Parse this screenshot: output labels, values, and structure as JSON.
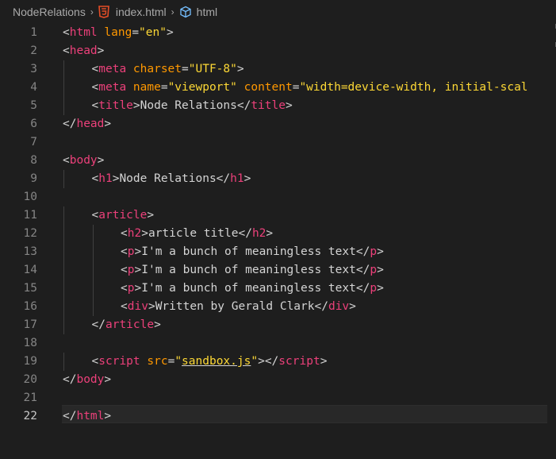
{
  "breadcrumb": {
    "folder": "NodeRelations",
    "file": "index.html",
    "symbol": "html",
    "separator": "›"
  },
  "editor": {
    "active_line": 22,
    "colors": {
      "background": "#1e1e1e",
      "tag": "#ec407a",
      "attribute": "#ff9800",
      "string": "#fdd835",
      "text": "#d4d4d4",
      "line_number": "#858585"
    },
    "lines": [
      {
        "n": "1",
        "indent": 0,
        "tokens": [
          [
            "br",
            "<"
          ],
          [
            "tag",
            "html"
          ],
          [
            "txt",
            " "
          ],
          [
            "attr",
            "lang"
          ],
          [
            "eq",
            "="
          ],
          [
            "str",
            "\"en\""
          ],
          [
            "br",
            ">"
          ]
        ]
      },
      {
        "n": "2",
        "indent": 0,
        "tokens": [
          [
            "br",
            "<"
          ],
          [
            "tag",
            "head"
          ],
          [
            "br",
            ">"
          ]
        ]
      },
      {
        "n": "3",
        "indent": 4,
        "tokens": [
          [
            "br",
            "<"
          ],
          [
            "tag",
            "meta"
          ],
          [
            "txt",
            " "
          ],
          [
            "attr",
            "charset"
          ],
          [
            "eq",
            "="
          ],
          [
            "str",
            "\"UTF-8\""
          ],
          [
            "br",
            ">"
          ]
        ]
      },
      {
        "n": "4",
        "indent": 4,
        "tokens": [
          [
            "br",
            "<"
          ],
          [
            "tag",
            "meta"
          ],
          [
            "txt",
            " "
          ],
          [
            "attr",
            "name"
          ],
          [
            "eq",
            "="
          ],
          [
            "str",
            "\"viewport\""
          ],
          [
            "txt",
            " "
          ],
          [
            "attr",
            "content"
          ],
          [
            "eq",
            "="
          ],
          [
            "str",
            "\"width=device-width, initial-scal"
          ]
        ]
      },
      {
        "n": "5",
        "indent": 4,
        "tokens": [
          [
            "br",
            "<"
          ],
          [
            "tag",
            "title"
          ],
          [
            "br",
            ">"
          ],
          [
            "txt",
            "Node Relations"
          ],
          [
            "br",
            "</"
          ],
          [
            "tag",
            "title"
          ],
          [
            "br",
            ">"
          ]
        ]
      },
      {
        "n": "6",
        "indent": 0,
        "tokens": [
          [
            "br",
            "</"
          ],
          [
            "tag",
            "head"
          ],
          [
            "br",
            ">"
          ]
        ]
      },
      {
        "n": "7",
        "indent": 0,
        "tokens": []
      },
      {
        "n": "8",
        "indent": 0,
        "tokens": [
          [
            "br",
            "<"
          ],
          [
            "tag",
            "body"
          ],
          [
            "br",
            ">"
          ]
        ]
      },
      {
        "n": "9",
        "indent": 4,
        "tokens": [
          [
            "br",
            "<"
          ],
          [
            "tag",
            "h1"
          ],
          [
            "br",
            ">"
          ],
          [
            "txt",
            "Node Relations"
          ],
          [
            "br",
            "</"
          ],
          [
            "tag",
            "h1"
          ],
          [
            "br",
            ">"
          ]
        ]
      },
      {
        "n": "10",
        "indent": 0,
        "tokens": []
      },
      {
        "n": "11",
        "indent": 4,
        "tokens": [
          [
            "br",
            "<"
          ],
          [
            "tag",
            "article"
          ],
          [
            "br",
            ">"
          ]
        ]
      },
      {
        "n": "12",
        "indent": 8,
        "tokens": [
          [
            "br",
            "<"
          ],
          [
            "tag",
            "h2"
          ],
          [
            "br",
            ">"
          ],
          [
            "txt",
            "article title"
          ],
          [
            "br",
            "</"
          ],
          [
            "tag",
            "h2"
          ],
          [
            "br",
            ">"
          ]
        ]
      },
      {
        "n": "13",
        "indent": 8,
        "tokens": [
          [
            "br",
            "<"
          ],
          [
            "tag",
            "p"
          ],
          [
            "br",
            ">"
          ],
          [
            "txt",
            "I'm a bunch of meaningless text"
          ],
          [
            "br",
            "</"
          ],
          [
            "tag",
            "p"
          ],
          [
            "br",
            ">"
          ]
        ]
      },
      {
        "n": "14",
        "indent": 8,
        "tokens": [
          [
            "br",
            "<"
          ],
          [
            "tag",
            "p"
          ],
          [
            "br",
            ">"
          ],
          [
            "txt",
            "I'm a bunch of meaningless text"
          ],
          [
            "br",
            "</"
          ],
          [
            "tag",
            "p"
          ],
          [
            "br",
            ">"
          ]
        ]
      },
      {
        "n": "15",
        "indent": 8,
        "tokens": [
          [
            "br",
            "<"
          ],
          [
            "tag",
            "p"
          ],
          [
            "br",
            ">"
          ],
          [
            "txt",
            "I'm a bunch of meaningless text"
          ],
          [
            "br",
            "</"
          ],
          [
            "tag",
            "p"
          ],
          [
            "br",
            ">"
          ]
        ]
      },
      {
        "n": "16",
        "indent": 8,
        "tokens": [
          [
            "br",
            "<"
          ],
          [
            "tag",
            "div"
          ],
          [
            "br",
            ">"
          ],
          [
            "txt",
            "Written by Gerald Clark"
          ],
          [
            "br",
            "</"
          ],
          [
            "tag",
            "div"
          ],
          [
            "br",
            ">"
          ]
        ]
      },
      {
        "n": "17",
        "indent": 4,
        "tokens": [
          [
            "br",
            "</"
          ],
          [
            "tag",
            "article"
          ],
          [
            "br",
            ">"
          ]
        ]
      },
      {
        "n": "18",
        "indent": 0,
        "tokens": []
      },
      {
        "n": "19",
        "indent": 4,
        "tokens": [
          [
            "br",
            "<"
          ],
          [
            "tag",
            "script"
          ],
          [
            "txt",
            " "
          ],
          [
            "attr",
            "src"
          ],
          [
            "eq",
            "="
          ],
          [
            "str",
            "\""
          ],
          [
            "link",
            "sandbox.js"
          ],
          [
            "str",
            "\""
          ],
          [
            "br",
            "></"
          ],
          [
            "tag",
            "script"
          ],
          [
            "br",
            ">"
          ]
        ]
      },
      {
        "n": "20",
        "indent": 0,
        "tokens": [
          [
            "br",
            "</"
          ],
          [
            "tag",
            "body"
          ],
          [
            "br",
            ">"
          ]
        ]
      },
      {
        "n": "21",
        "indent": 0,
        "tokens": []
      },
      {
        "n": "22",
        "indent": 0,
        "tokens": [
          [
            "br",
            "</"
          ],
          [
            "tag",
            "html"
          ],
          [
            "br",
            ">"
          ]
        ]
      }
    ]
  }
}
